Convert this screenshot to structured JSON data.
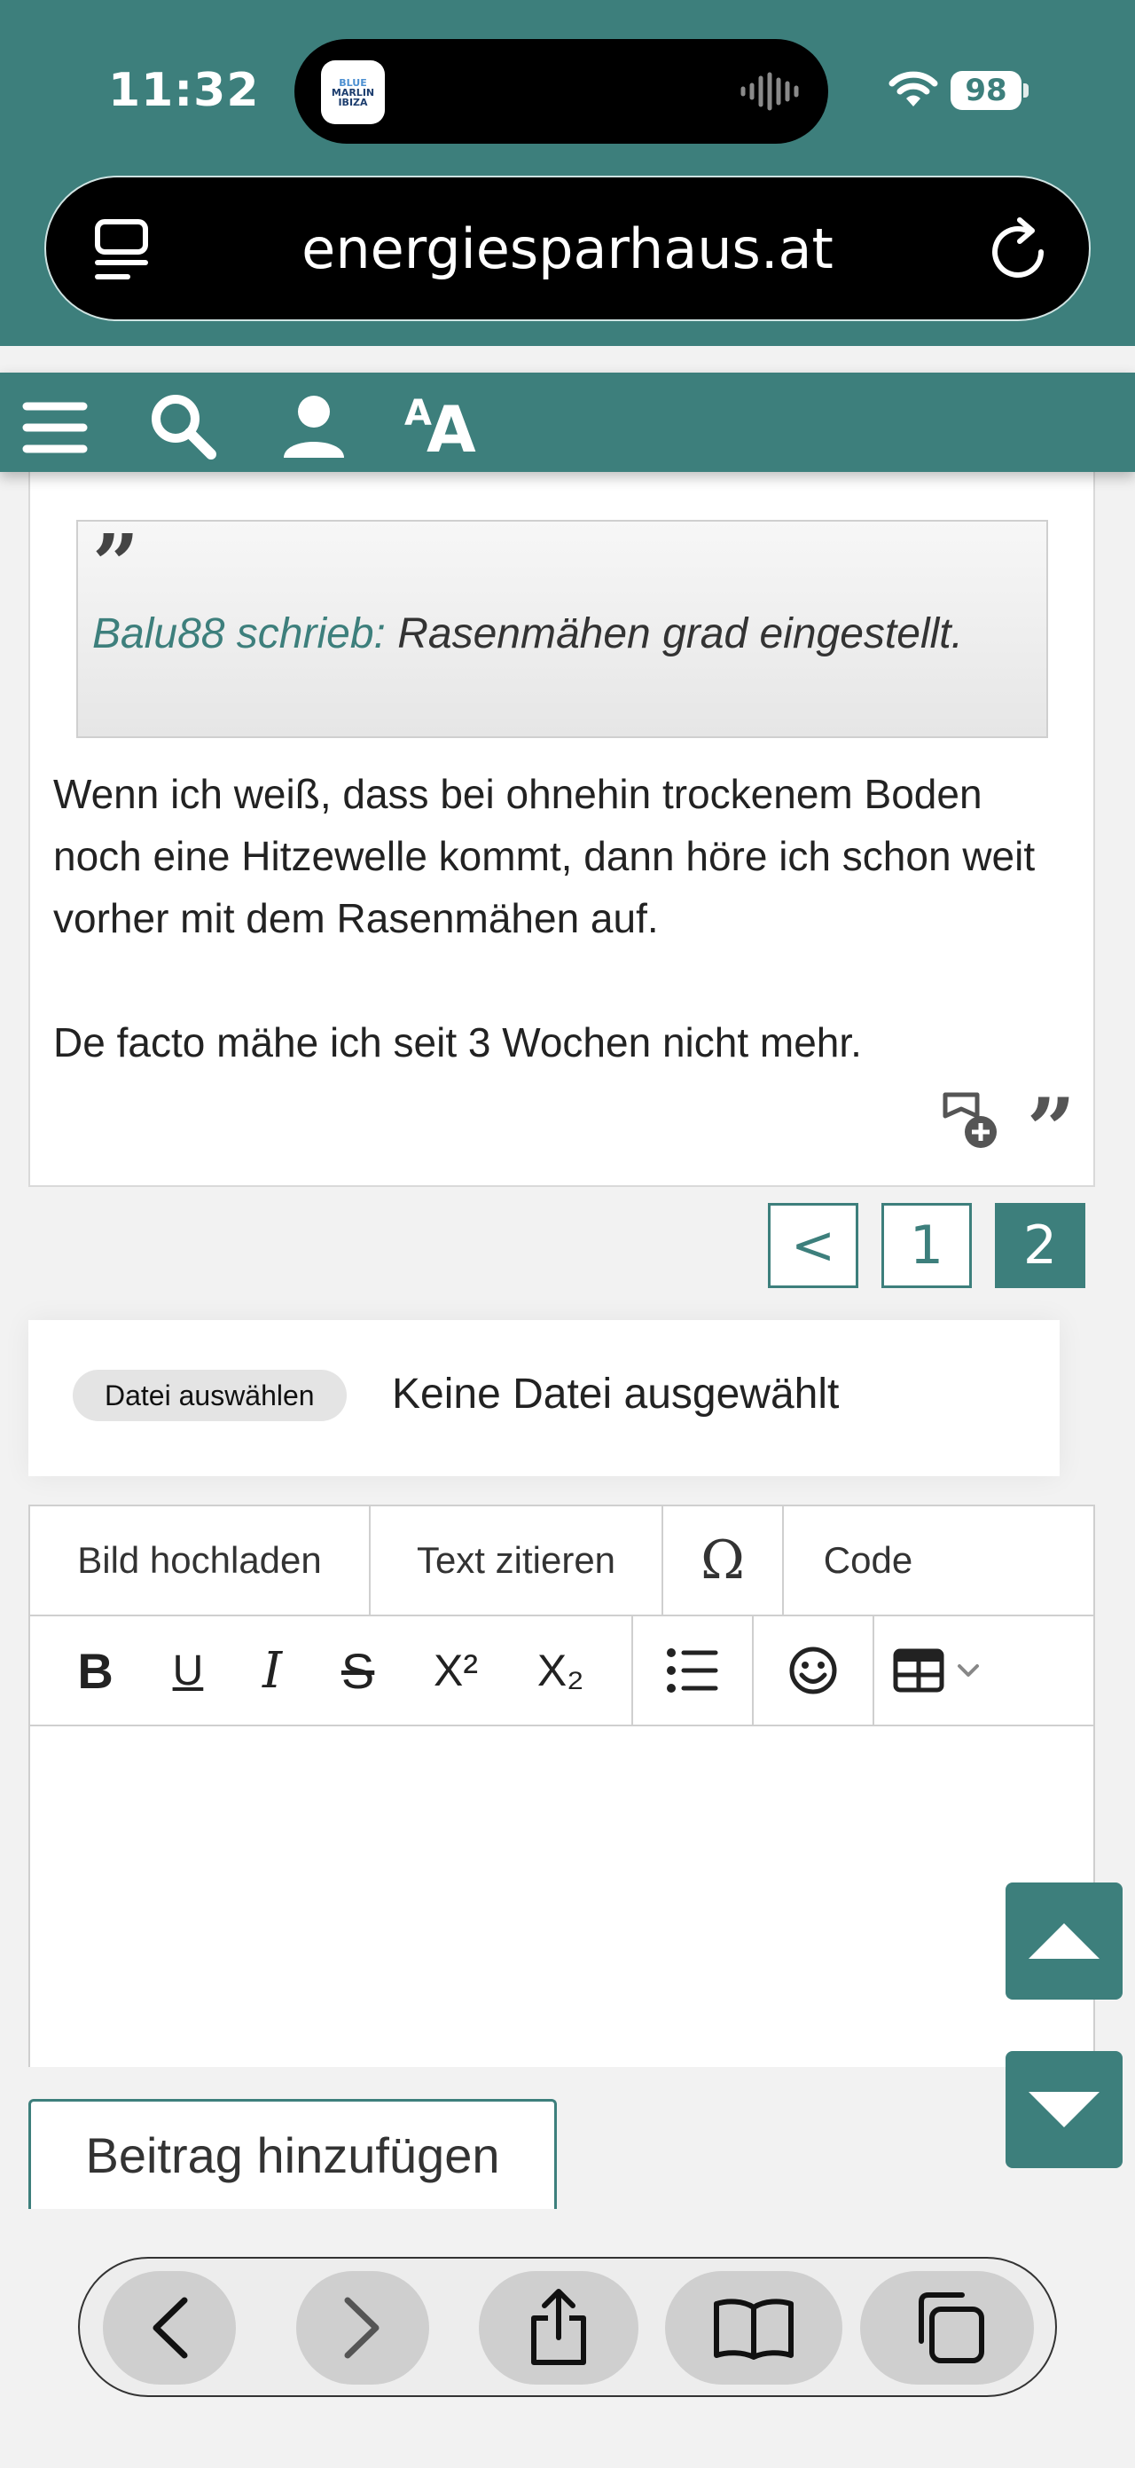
{
  "status_bar": {
    "time": "11:32",
    "island_app": [
      "BLUE",
      "MARLIN",
      "IBIZA"
    ],
    "battery": "98"
  },
  "address_bar": {
    "url": "energiesparhaus.at"
  },
  "site_nav": {
    "icons": [
      "menu-icon",
      "search-icon",
      "user-icon",
      "text-size-icon"
    ],
    "text_size_label_small": "A",
    "text_size_label_big": "A"
  },
  "post": {
    "quote_mark": "”",
    "quote_author": "Balu88 schrieb:",
    "quote_text": "Rasenmähen grad eingestellt.",
    "paragraphs": [
      "Wenn ich weiß, dass bei ohnehin trockenem Boden noch eine Hitzewelle kommt, dann höre ich schon weit vorher mit dem Rasenmähen auf.",
      "De facto mähe ich seit 3 Wochen nicht mehr."
    ],
    "quote_action": "”"
  },
  "pagination": {
    "prev": "<",
    "pages": [
      "1",
      "2"
    ],
    "current": "2"
  },
  "file_upload": {
    "button": "Datei auswählen",
    "status": "Keine Datei ausgewählt"
  },
  "editor": {
    "row1": [
      "Bild hochladen",
      "Text zitieren",
      "Ω",
      "Code"
    ],
    "format_labels": {
      "bold": "B",
      "underline": "U",
      "italic": "I",
      "strike": "S",
      "superscript": "X²",
      "subscript": "X₂"
    }
  },
  "submit": {
    "label": "Beitrag hinzufügen"
  },
  "colors": {
    "accent": "#3d7f7c",
    "quote_author": "#3d7f7c"
  }
}
